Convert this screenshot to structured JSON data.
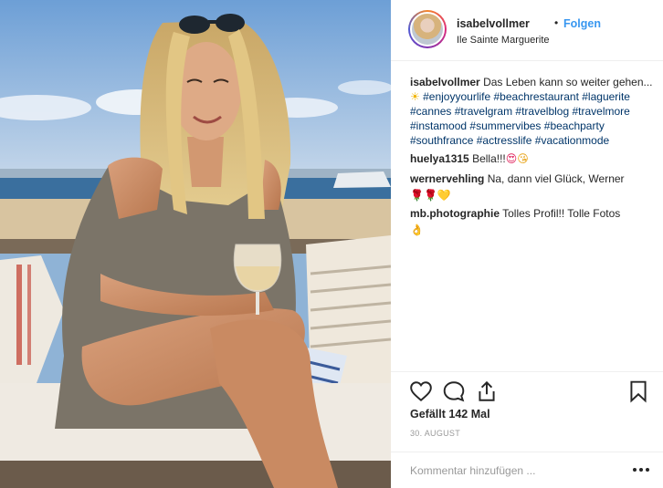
{
  "header": {
    "username": "isabelvollmer",
    "separator": "•",
    "follow_label": "Folgen",
    "location": "Ile Sainte Marguerite"
  },
  "caption": {
    "username": "isabelvollmer",
    "text": "Das Leben kann so weiter gehen...",
    "emoji": "☀",
    "hashtags": [
      "#enjoyyourlife",
      "#beachrestaurant",
      "#laguerite",
      "#cannes",
      "#travelgram",
      "#travelblog",
      "#travelmore",
      "#instamood",
      "#summervibes",
      "#beachparty",
      "#southfrance",
      "#actresslife",
      "#vacationmode"
    ]
  },
  "comments": [
    {
      "username": "huelya1315",
      "text": "Bella!!!",
      "emoji": [
        "😍",
        "😘"
      ]
    },
    {
      "username": "wernervehling",
      "text": "Na, dann viel Glück, Werner",
      "emoji": [
        "🌹",
        "🌹",
        "💛"
      ]
    },
    {
      "username": "mb.photographie",
      "text": "Tolles Profil!! Tolle Fotos",
      "emoji": [
        "👌"
      ]
    }
  ],
  "actions": {
    "like_icon": "heart-outline-icon",
    "comment_icon": "speech-bubble-icon",
    "share_icon": "share-upload-icon",
    "save_icon": "bookmark-icon"
  },
  "likes_text": "Gefällt 142 Mal",
  "date": "30. AUGUST",
  "add_comment": {
    "placeholder": "Kommentar hinzufügen ...",
    "more_icon": "ellipsis-icon"
  },
  "colors": {
    "link": "#3897f0",
    "hashtag": "#003569",
    "text": "#262626",
    "muted": "#999999",
    "border": "#efefef"
  }
}
